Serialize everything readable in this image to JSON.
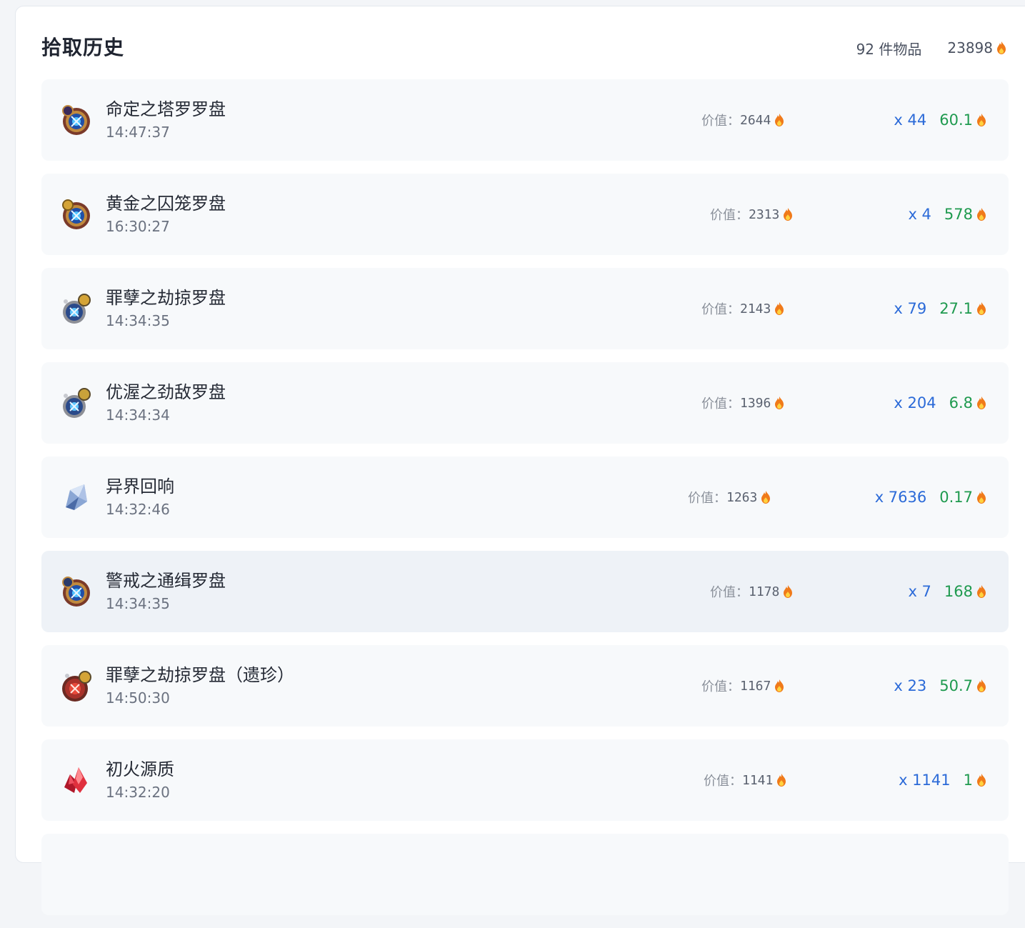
{
  "header": {
    "title": "拾取历史",
    "item_count": "92 件物品",
    "total_value": "23898"
  },
  "value_label": "价值：",
  "colors": {
    "quantity": "#2b6ad8",
    "unit_price": "#1f9a4f",
    "flame": "#f07a1a"
  },
  "items": [
    {
      "name": "命定之塔罗罗盘",
      "time": "14:47:37",
      "value": "2644",
      "quantity": "x 44",
      "unit_price": "60.1",
      "icon": "compass-blue-icon"
    },
    {
      "name": "黄金之囚笼罗盘",
      "time": "16:30:27",
      "value": "2313",
      "quantity": "x 4",
      "unit_price": "578",
      "icon": "compass-gold-icon"
    },
    {
      "name": "罪孽之劫掠罗盘",
      "time": "14:34:35",
      "value": "2143",
      "quantity": "x 79",
      "unit_price": "27.1",
      "icon": "compass-silver-icon"
    },
    {
      "name": "优渥之劲敌罗盘",
      "time": "14:34:34",
      "value": "1396",
      "quantity": "x 204",
      "unit_price": "6.8",
      "icon": "compass-silver-icon"
    },
    {
      "name": "异界回响",
      "time": "14:32:46",
      "value": "1263",
      "quantity": "x 7636",
      "unit_price": "0.17",
      "icon": "crystal-shard-icon"
    },
    {
      "name": "警戒之通缉罗盘",
      "time": "14:34:35",
      "value": "1178",
      "quantity": "x 7",
      "unit_price": "168",
      "icon": "compass-blue-icon"
    },
    {
      "name": "罪孽之劫掠罗盘（遗珍）",
      "time": "14:50:30",
      "value": "1167",
      "quantity": "x 23",
      "unit_price": "50.7",
      "icon": "compass-red-icon"
    },
    {
      "name": "初火源质",
      "time": "14:32:20",
      "value": "1141",
      "quantity": "x 1141",
      "unit_price": "1",
      "icon": "red-crystal-icon"
    }
  ]
}
